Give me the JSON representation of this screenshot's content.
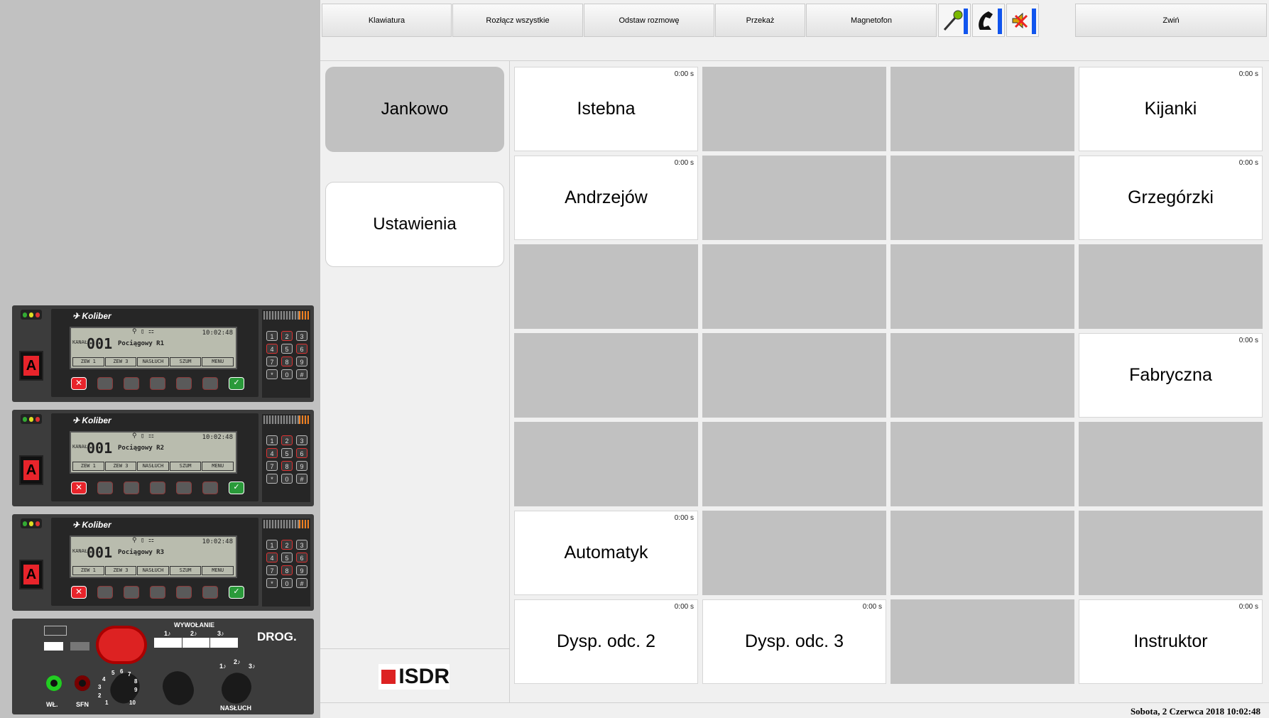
{
  "toolbar": {
    "keyboard": "Klawiatura",
    "disconnect_all": "Rozłącz wszystkie",
    "hold_call": "Odstaw rozmowę",
    "transfer": "Przekaż",
    "recorder": "Magnetofon",
    "collapse": "Zwiń",
    "icons": [
      "microphone-icon",
      "handset-icon",
      "speaker-mute-icon"
    ]
  },
  "nav": {
    "station": "Jankowo",
    "settings": "Ustawienia",
    "logo_text": "ISDR"
  },
  "grid": [
    [
      {
        "name": "Istebna",
        "time": "0:00 s"
      },
      null,
      null,
      {
        "name": "Kijanki",
        "time": "0:00 s"
      }
    ],
    [
      {
        "name": "Andrzejów",
        "time": "0:00 s"
      },
      null,
      null,
      {
        "name": "Grzegórzki",
        "time": "0:00 s"
      }
    ],
    [
      null,
      null,
      null,
      null
    ],
    [
      null,
      null,
      null,
      {
        "name": "Fabryczna",
        "time": "0:00 s"
      }
    ],
    [
      null,
      null,
      null,
      null
    ],
    [
      {
        "name": "Automatyk",
        "time": "0:00 s"
      },
      null,
      null,
      null
    ],
    [
      {
        "name": "Dysp. odc. 2",
        "time": "0:00 s"
      },
      {
        "name": "Dysp. odc. 3",
        "time": "0:00 s"
      },
      null,
      {
        "name": "Instruktor",
        "time": "0:00 s"
      }
    ]
  ],
  "radios": [
    {
      "brand": "Koliber",
      "kanal": "KANAŁ",
      "channel": "001",
      "train": "Pociągowy R1",
      "clock": "10:02:48",
      "softkeys": [
        "ZEW 1",
        "ZEW 3",
        "NASŁUCH",
        "SZUM",
        "MENU"
      ]
    },
    {
      "brand": "Koliber",
      "kanal": "KANAŁ",
      "channel": "001",
      "train": "Pociągowy R2",
      "clock": "10:02:48",
      "softkeys": [
        "ZEW 1",
        "ZEW 3",
        "NASŁUCH",
        "SZUM",
        "MENU"
      ]
    },
    {
      "brand": "Koliber",
      "kanal": "KANAŁ",
      "channel": "001",
      "train": "Pociągowy R3",
      "clock": "10:02:48",
      "softkeys": [
        "ZEW 1",
        "ZEW 3",
        "NASŁUCH",
        "SZUM",
        "MENU"
      ]
    }
  ],
  "radio_pad_keys": [
    "1",
    "2",
    "3",
    "4",
    "5",
    "6",
    "7",
    "8",
    "9",
    "*",
    "0",
    "#"
  ],
  "radio_button_letter": "A",
  "drog": {
    "title": "DROG.",
    "call_label": "WYWOŁANIE",
    "call_tones": [
      "1♪",
      "2♪",
      "3♪"
    ],
    "power_label": "WŁ.",
    "sfn_label": "SFN",
    "listen_label": "NASŁUCH",
    "dial_numbers": [
      "1",
      "2",
      "3",
      "4",
      "5",
      "6",
      "7",
      "8",
      "9",
      "10"
    ],
    "listen_tones": [
      "1♪",
      "2♪",
      "3♪"
    ]
  },
  "status": {
    "date_time": "Sobota, 2 Czerwca 2018   10:02:48"
  },
  "colors": {
    "active_cell": "#ffffff",
    "inactive_cell": "#c1c1c1",
    "accent_bar": "#1155ee",
    "logo_red": "#d22222"
  }
}
